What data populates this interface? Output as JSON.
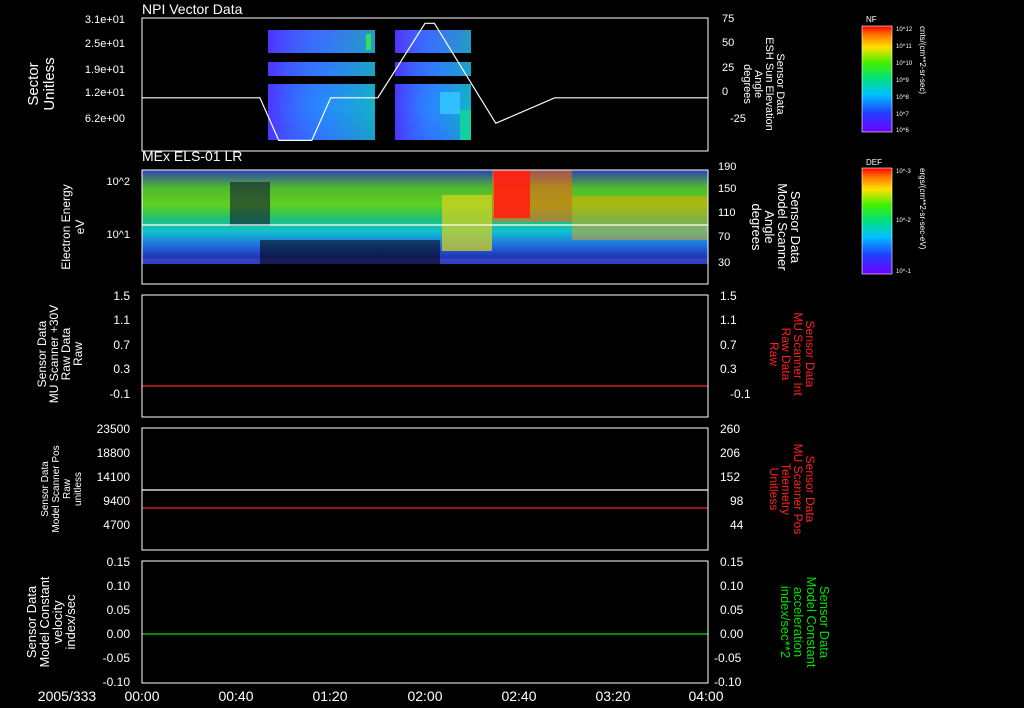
{
  "date_label": "2005/333",
  "time_ticks": [
    "00:00",
    "00:40",
    "01:20",
    "02:00",
    "02:40",
    "03:20",
    "04:00"
  ],
  "colors": {
    "white": "#ffffff",
    "red": "#ff2020",
    "green": "#00e000",
    "black": "#000000"
  },
  "chart_data": [
    {
      "type": "heatmap",
      "title": "NPI Vector Data",
      "ylabel": [
        "Sector",
        "Unitless"
      ],
      "ytick_labels": [
        "3.1e+01",
        "2.5e+01",
        "1.9e+01",
        "1.2e+01",
        "6.2e+00"
      ],
      "right_ylabel": [
        "Sensor Data",
        "ESH Sun Elevation",
        "Angle",
        "degrees"
      ],
      "right_ytick_labels": [
        "75",
        "50",
        "25",
        "0",
        "-25"
      ],
      "right_ylim": [
        -50,
        75
      ],
      "colorbar": {
        "label": "NF",
        "units": "cnts/(cm**2-sr-sec)",
        "tick_labels": [
          "10^12",
          "10^11",
          "10^10",
          "10^9",
          "10^8",
          "10^7",
          "10^6"
        ]
      },
      "data_blocks": [
        {
          "start": "00:49",
          "end": "01:17"
        },
        {
          "start": "01:36",
          "end": "02:12"
        }
      ],
      "overlay_line": {
        "name": "Sensor Data ESH Sun Elevation Angle",
        "color": "white",
        "points": [
          [
            0,
            0
          ],
          [
            50,
            0
          ],
          [
            58,
            -40
          ],
          [
            72,
            -40
          ],
          [
            80,
            0
          ],
          [
            100,
            0
          ],
          [
            120,
            70
          ],
          [
            124,
            70
          ],
          [
            150,
            -24
          ],
          [
            175,
            0
          ],
          [
            240,
            0
          ]
        ]
      }
    },
    {
      "type": "heatmap",
      "title": "MEx ELS-01 LR",
      "ylabel": [
        "Electron Energy",
        "eV"
      ],
      "ytick_labels": [
        "10^2",
        "10^1"
      ],
      "right_ylabel": [
        "Sensor Data",
        "Model Scanner",
        "Angle",
        "degrees"
      ],
      "right_ytick_labels": [
        "190",
        "150",
        "110",
        "70",
        "30"
      ],
      "right_ylim": [
        10,
        190
      ],
      "colorbar": {
        "label": "DEF",
        "units": "ergs/(cm**2-sr-sec-eV)",
        "tick_labels": [
          "10^-1",
          "10^-2",
          "10^-3"
        ]
      },
      "overlay_line": {
        "name": "Model Scanner Angle",
        "color": "white",
        "value": 100
      }
    },
    {
      "type": "line",
      "ylabel": [
        "Sensor Data",
        "MU Scanner +30V",
        "Raw Data",
        "Raw"
      ],
      "ytick_labels": [
        "1.5",
        "1.1",
        "0.7",
        "0.3",
        "-0.1"
      ],
      "ylim": [
        -0.34,
        1.5
      ],
      "right_ylabel": [
        "Sensor Data",
        "MU Scanner Int",
        "Raw Data",
        "Raw"
      ],
      "right_ytick_labels": [
        "1.5",
        "1.1",
        "0.7",
        "0.3",
        "-0.1"
      ],
      "series": [
        {
          "color": "red",
          "x": [
            "00:00",
            "04:00"
          ],
          "values": [
            0.0,
            0.0
          ]
        }
      ]
    },
    {
      "type": "line",
      "ylabel": [
        "Sensor Data",
        "Model Scanner Pos",
        "Raw",
        "unitless"
      ],
      "ytick_labels": [
        "23500",
        "18800",
        "14100",
        "9400",
        "4700"
      ],
      "ylim": [
        0,
        23500
      ],
      "right_ylabel": [
        "Sensor Data",
        "MU Scanner Pos",
        "Telemetry",
        "Unitless"
      ],
      "right_ytick_labels": [
        "260",
        "206",
        "152",
        "98",
        "44"
      ],
      "right_ylim": [
        -10,
        260
      ],
      "series": [
        {
          "color": "white",
          "axis": "left",
          "x": [
            "00:00",
            "04:00"
          ],
          "values": [
            11750,
            11750
          ]
        },
        {
          "color": "red",
          "axis": "right",
          "x": [
            "00:00",
            "04:00"
          ],
          "values": [
            100,
            100
          ]
        }
      ]
    },
    {
      "type": "line",
      "ylabel": [
        "Sensor Data",
        "Model Constant",
        "velocity",
        "index/sec"
      ],
      "ytick_labels": [
        "0.15",
        "0.10",
        "0.05",
        "0.00",
        "-0.05",
        "-0.10"
      ],
      "ylim": [
        -0.1,
        0.15
      ],
      "right_ylabel": [
        "Sensor Data",
        "Model Constant",
        "acceleration",
        "index/sec**2"
      ],
      "right_ytick_labels": [
        "0.15",
        "0.10",
        "0.05",
        "0.00",
        "-0.05",
        "-0.10"
      ],
      "series": [
        {
          "color": "green",
          "x": [
            "00:00",
            "04:00"
          ],
          "values": [
            0.0,
            0.0
          ]
        }
      ]
    }
  ]
}
